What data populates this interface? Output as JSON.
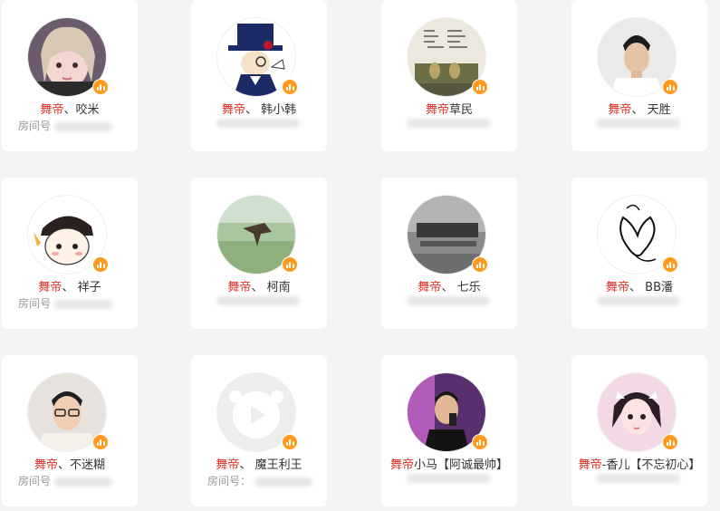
{
  "brand_color": "#e0322b",
  "badge_color": "#ff9a1f",
  "room_label": "房间号",
  "room_label_colon": "房间号：",
  "cards": [
    {
      "brand": "舞帝",
      "rest": "、咬米"
    },
    {
      "brand": "舞帝",
      "rest": "、 韩小韩"
    },
    {
      "brand": "舞帝",
      "rest": "草民"
    },
    {
      "brand": "舞帝",
      "rest": "、 天胜"
    },
    {
      "brand": "舞帝",
      "rest": "、 祥子"
    },
    {
      "brand": "舞帝",
      "rest": "、 柯南"
    },
    {
      "brand": "舞帝",
      "rest": "、 七乐"
    },
    {
      "brand": "舞帝",
      "rest": "、 BB潘"
    },
    {
      "brand": "舞帝",
      "rest": "、不迷糊"
    },
    {
      "brand": "舞帝",
      "rest": "、 魔王利王"
    },
    {
      "brand": "舞帝",
      "rest": "小马【阿诚最帅】"
    },
    {
      "brand": "舞帝",
      "rest": "-香儿【不忘初心】"
    }
  ]
}
